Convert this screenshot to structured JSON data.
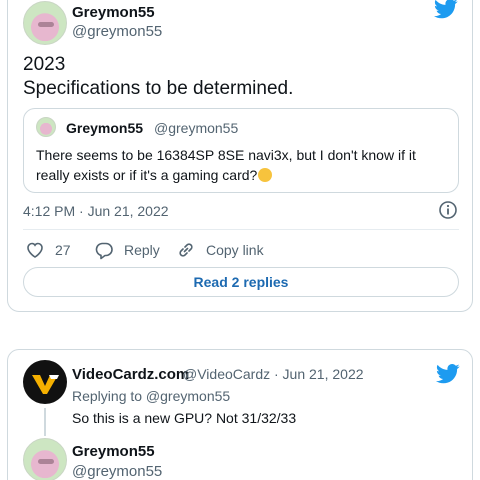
{
  "tweet": {
    "display_name": "Greymon55",
    "handle": "@greymon55",
    "text_line1": "2023",
    "text_line2": "Specifications to be determined.",
    "quote": {
      "display_name": "Greymon55",
      "handle": "@greymon55",
      "text": "There seems to be 16384SP 8SE navi3x, but I don't know if it really exists or if it's a gaming card?"
    },
    "timestamp": "4:12 PM · Jun 21, 2022",
    "like_count": "27",
    "reply_label": "Reply",
    "copy_link_label": "Copy link",
    "read_replies_label": "Read 2 replies"
  },
  "reply_tweet": {
    "display_name": "VideoCardz.com",
    "handle_and_date": "@VideoCardz · Jun 21, 2022",
    "replying_to": "Replying to @greymon55",
    "text": "So this is a new GPU? Not 31/32/33"
  },
  "nested_tweet": {
    "display_name": "Greymon55",
    "handle": "@greymon55"
  },
  "colors": {
    "twitter_blue": "#1d9bf0",
    "link_blue": "#1d6ab1",
    "muted": "#536471",
    "border": "#cfd9de"
  }
}
